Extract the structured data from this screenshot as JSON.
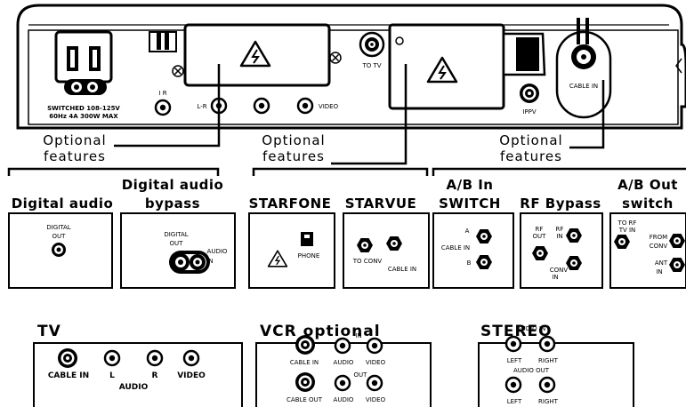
{
  "back_panel": {
    "power_label_1": "SWITCHED 108-125V",
    "power_label_2": "60Hz 4A 300W MAX",
    "ir_label": "I R",
    "lr_label": "L-R",
    "video_label": "VIDEO",
    "to_tv_label": "TO TV",
    "ippv_label": "IPPV",
    "cable_in_label": "CABLE IN"
  },
  "groups": {
    "left": {
      "opt1": "Optional",
      "opt2": "features"
    },
    "middle": {
      "opt1": "Optional",
      "opt2": "features"
    },
    "right": {
      "opt1": "Optional",
      "opt2": "features"
    }
  },
  "modules": {
    "digital_audio": {
      "title": "Digital audio",
      "label1": "DIGITAL",
      "label2": "OUT"
    },
    "digital_audio_bypass": {
      "title1": "Digital audio",
      "title2": "bypass",
      "label_digital": "DIGITAL",
      "label_out": "OUT",
      "label_audio": "AUDIO",
      "label_in": "IN"
    },
    "starfone": {
      "title": "STARFONE",
      "label": "PHONE"
    },
    "starvue": {
      "title": "STARVUE",
      "to_conv": "TO CONV",
      "cable_in": "CABLE IN"
    },
    "ab_in": {
      "title1": "A/B In",
      "title2": "SWITCH",
      "a": "A",
      "cable_in": "CABLE IN",
      "b": "B"
    },
    "rf_bypass": {
      "title": "RF Bypass",
      "rf_out_1": "RF",
      "rf_out_2": "OUT",
      "rf_in_1": "RF",
      "rf_in_2": "IN",
      "conv_1": "CONV",
      "conv_2": "IN"
    },
    "ab_out": {
      "title1": "A/B Out",
      "title2": "switch",
      "to_rf_1": "TO RF",
      "to_rf_2": "TV IN",
      "from_1": "FROM",
      "from_2": "CONV",
      "ant_1": "ANT",
      "ant_2": "IN"
    }
  },
  "panels": {
    "tv": {
      "title": "TV",
      "cable_in": "CABLE IN",
      "l": "L",
      "r": "R",
      "video": "VIDEO",
      "audio": "AUDIO"
    },
    "vcr": {
      "title": "VCR optional",
      "in": "IN",
      "out": "OUT",
      "cable_in": "CABLE IN",
      "cable_out": "CABLE OUT",
      "audio1": "AUDIO",
      "video1": "VIDEO",
      "audio2": "AUDIO",
      "video2": "VIDEO"
    },
    "stereo": {
      "title": "STEREO",
      "audio_in": "AUDIO IN",
      "audio_out": "AUDIO OUT",
      "left1": "LEFT",
      "right1": "RIGHT",
      "left2": "LEFT",
      "right2": "RIGHT"
    }
  }
}
